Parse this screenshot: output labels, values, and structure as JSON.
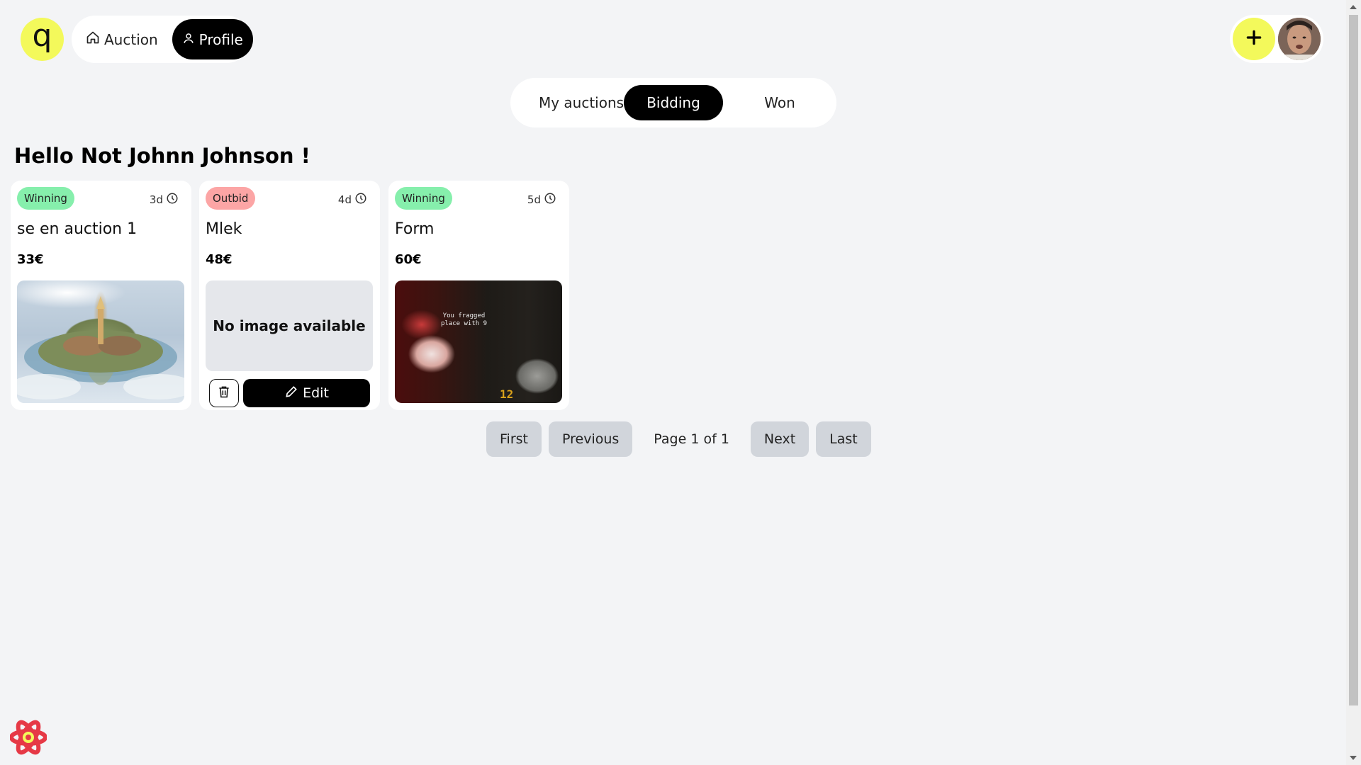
{
  "header": {
    "logo_letter": "q",
    "nav": [
      {
        "label": "Auction",
        "icon": "home-icon",
        "active": false
      },
      {
        "label": "Profile",
        "icon": "user-icon",
        "active": true
      }
    ],
    "add_icon": "plus-icon"
  },
  "tabs": [
    {
      "label": "My auctions",
      "active": false
    },
    {
      "label": "Bidding",
      "active": true
    },
    {
      "label": "Won",
      "active": false
    }
  ],
  "greeting": "Hello Not Johnn Johnson !",
  "cards": [
    {
      "status": "Winning",
      "time_left": "3d",
      "title": "se en auction 1",
      "price": "33€",
      "image": "floating-island-image"
    },
    {
      "status": "Outbid",
      "time_left": "4d",
      "title": "Mlek",
      "price": "48€",
      "image_placeholder": "No image available",
      "edit_label": "Edit"
    },
    {
      "status": "Winning",
      "time_left": "5d",
      "title": "Form",
      "price": "60€",
      "image": "game-screenshot-image",
      "image_text_line1": "You fragged",
      "image_text_line2": "place with 9",
      "image_hud": "12"
    }
  ],
  "pagination": {
    "first": "First",
    "previous": "Previous",
    "page_label": "Page 1 of 1",
    "next": "Next",
    "last": "Last"
  },
  "colors": {
    "accent": "#f3f95b",
    "winning": "#86efac",
    "outbid": "#fca5a5",
    "background": "#f3f4f6"
  }
}
